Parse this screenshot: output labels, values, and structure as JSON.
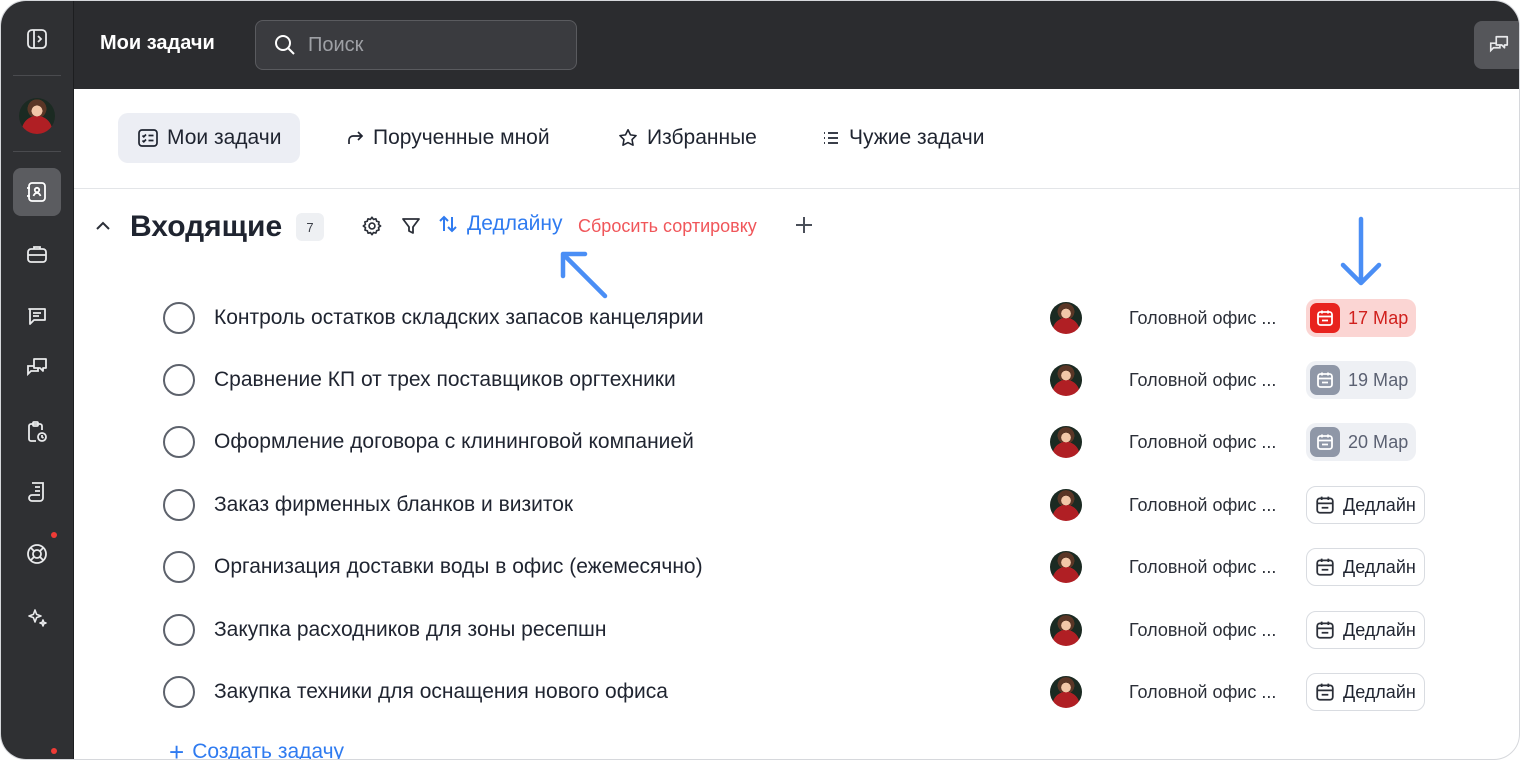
{
  "topbar": {
    "title": "Мои задачи",
    "search_placeholder": "Поиск"
  },
  "tabs": [
    {
      "label": "Мои задачи",
      "icon": "tasks-icon",
      "active": true
    },
    {
      "label": "Порученные мной",
      "icon": "forward-arrow-icon",
      "active": false
    },
    {
      "label": "Избранные",
      "icon": "star-icon",
      "active": false
    },
    {
      "label": "Чужие задачи",
      "icon": "list-icon",
      "active": false
    }
  ],
  "section": {
    "title": "Входящие",
    "count": "7",
    "sort_label": "Дедлайну",
    "reset_label": "Сбросить сортировку"
  },
  "tasks": [
    {
      "title": "Контроль остатков складских запасов канцелярии",
      "project": "Головной офис ...",
      "deadline": "17 Мар",
      "deadline_state": "overdue"
    },
    {
      "title": "Сравнение КП от трех поставщиков оргтехники",
      "project": "Головной офис ...",
      "deadline": "19 Мар",
      "deadline_state": "soon"
    },
    {
      "title": "Оформление договора с клининговой компанией",
      "project": "Головной офис ...",
      "deadline": "20 Мар",
      "deadline_state": "soon"
    },
    {
      "title": "Заказ фирменных бланков и визиток",
      "project": "Головной офис ...",
      "deadline": "Дедлайн",
      "deadline_state": "empty"
    },
    {
      "title": "Организация доставки воды в офис (ежемесячно)",
      "project": "Головной офис ...",
      "deadline": "Дедлайн",
      "deadline_state": "empty"
    },
    {
      "title": "Закупка расходников для зоны ресепшн",
      "project": "Головной офис ...",
      "deadline": "Дедлайн",
      "deadline_state": "empty"
    },
    {
      "title": "Закупка техники для оснащения нового офиса",
      "project": "Головной офис ...",
      "deadline": "Дедлайн",
      "deadline_state": "empty"
    }
  ],
  "create_task_label": "Создать задачу",
  "colors": {
    "accent": "#2f7bf0",
    "danger": "#f0565a",
    "overdue_bg": "#fbd5d3",
    "rail_bg": "#2f3033"
  }
}
